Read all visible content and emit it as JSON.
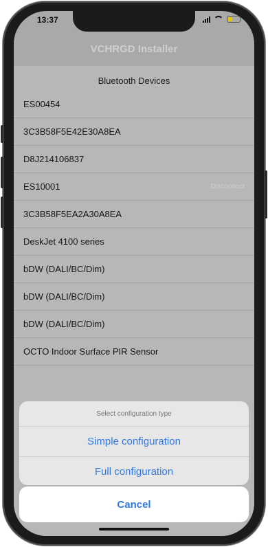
{
  "status_bar": {
    "time": "13:37"
  },
  "nav": {
    "title": "VCHRGD Installer"
  },
  "devices": {
    "section_title": "Bluetooth Devices",
    "items": [
      {
        "name": "ES00454",
        "action": ""
      },
      {
        "name": "3C3B58F5E42E30A8EA",
        "action": ""
      },
      {
        "name": "D8J214106837",
        "action": ""
      },
      {
        "name": "ES10001",
        "action": "Disconnect"
      },
      {
        "name": "3C3B58F5EA2A30A8EA",
        "action": ""
      },
      {
        "name": "DeskJet 4100 series",
        "action": ""
      },
      {
        "name": "bDW (DALI/BC/Dim)",
        "action": ""
      },
      {
        "name": "bDW (DALI/BC/Dim)",
        "action": ""
      },
      {
        "name": "bDW (DALI/BC/Dim)",
        "action": ""
      },
      {
        "name": "OCTO Indoor Surface PIR Sensor",
        "action": ""
      }
    ]
  },
  "action_sheet": {
    "title": "Select configuration type",
    "options": [
      "Simple configuration",
      "Full configuration"
    ],
    "cancel": "Cancel"
  }
}
